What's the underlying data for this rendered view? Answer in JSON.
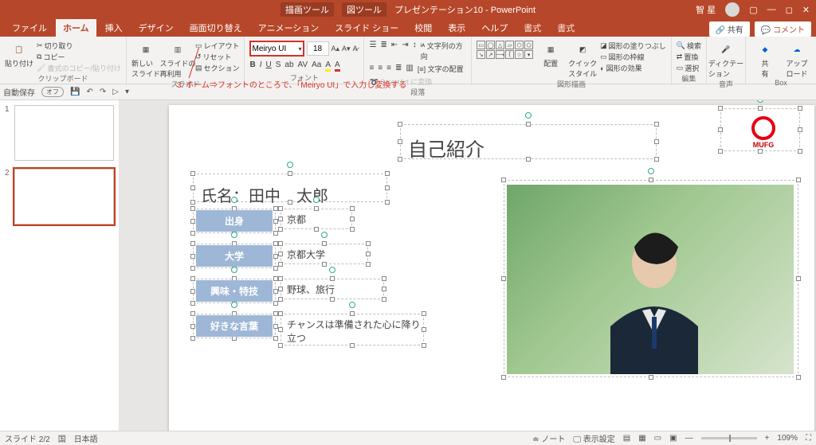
{
  "titlebar": {
    "tool1": "描画ツール",
    "tool2": "図ツール",
    "doc": "プレゼンテーション10 - PowerPoint",
    "user": "智 星"
  },
  "tabs": {
    "file": "ファイル",
    "home": "ホーム",
    "insert": "挿入",
    "design": "デザイン",
    "transitions": "画面切り替え",
    "animations": "アニメーション",
    "slideshow": "スライド ショー",
    "review": "校閲",
    "view": "表示",
    "help": "ヘルプ",
    "format1": "書式",
    "format2": "書式",
    "share": "共有",
    "comment": "コメント"
  },
  "ribbon": {
    "clipboard": {
      "paste": "貼り付け",
      "cut": "切り取り",
      "copy": "コピー",
      "formatpainter": "書式のコピー/貼り付け",
      "label": "クリップボード"
    },
    "slides": {
      "new": "新しい\nスライド",
      "reuse": "スライドの\n再利用",
      "layout": "レイアウト",
      "reset": "リセット",
      "section": "セクション",
      "label": "スライド"
    },
    "font": {
      "name": "Meiryo UI",
      "size": "18",
      "label": "フォント"
    },
    "paragraph": {
      "direction": "文字列の方向",
      "align": "文字の配置",
      "smartart": "SmartArt に変換",
      "label": "段落"
    },
    "drawing": {
      "arrange": "配置",
      "quick": "クイック\nスタイル",
      "fill": "図形の塗りつぶし",
      "outline": "図形の枠線",
      "effect": "図形の効果",
      "label": "図形描画"
    },
    "editing": {
      "find": "検索",
      "replace": "置換",
      "select": "選択",
      "label": "編集"
    },
    "voice": {
      "dictate": "ディクテー\nション",
      "label": "音声"
    },
    "box": {
      "kyoyu": "共\n有",
      "upload": "アップ\nロード",
      "label": "Box"
    }
  },
  "qat": {
    "autosave": "自動保存",
    "state": "オフ"
  },
  "annotation": "3. ホーム⇒フォントのところで、「Meiryo UI」で入力し変換する",
  "slide": {
    "title": "自己紹介",
    "name_label": "氏名：",
    "name_value": "田中　太郎",
    "rows": [
      {
        "label": "出身",
        "value": "京都"
      },
      {
        "label": "大学",
        "value": "京都大学"
      },
      {
        "label": "興味・特技",
        "value": "野球、旅行"
      },
      {
        "label": "好きな言葉",
        "value": "チャンスは準備された心に降り立つ"
      }
    ],
    "logo_text": "MUFG"
  },
  "status": {
    "slide": "スライド 2/2",
    "lang_code": "国",
    "lang": "日本語",
    "notes": "ノート",
    "display": "表示設定",
    "zoom": "109%"
  },
  "chart_data": null
}
